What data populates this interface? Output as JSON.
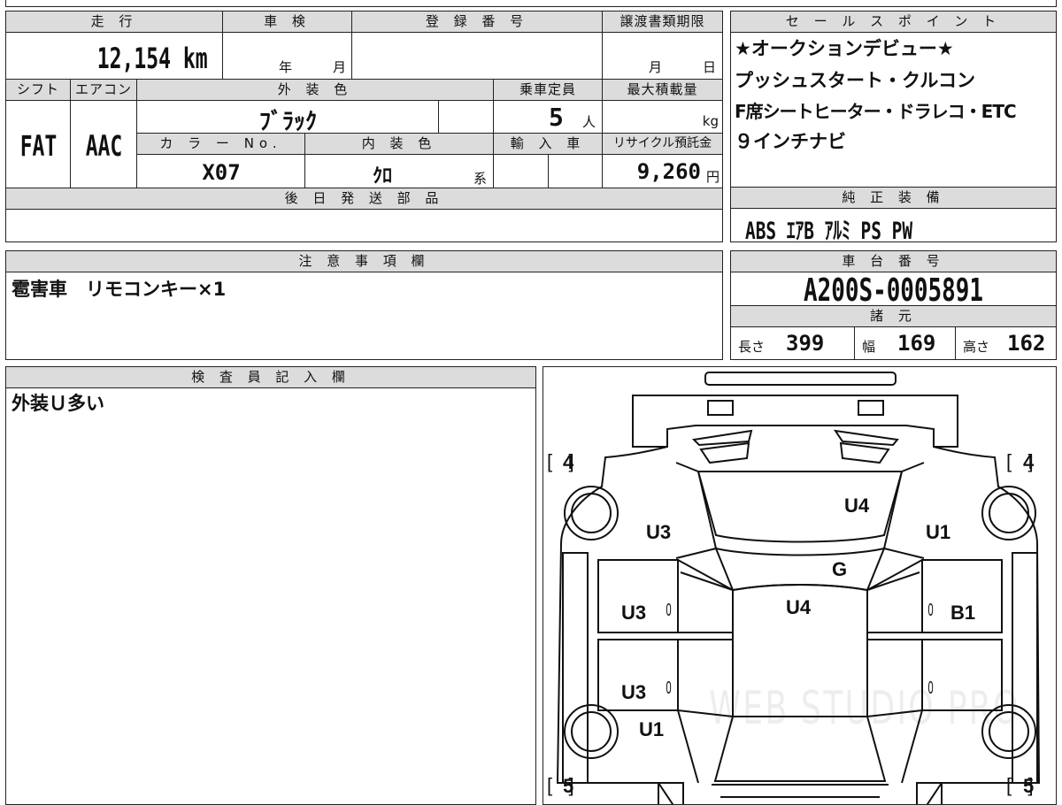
{
  "left_panel": {
    "mileage_label": "走 行",
    "mileage_value": "12,154 km",
    "inspection_label": "車 検",
    "inspection_year_unit": "年",
    "inspection_month_unit": "月",
    "registration_label": "登 録 番 号",
    "registration_value": "",
    "transfer_deadline_label": "譲渡書類期限",
    "transfer_month_unit": "月",
    "transfer_day_unit": "日",
    "shift_label": "シフト",
    "shift_value": "FAT",
    "aircon_label": "エアコン",
    "aircon_value": "AAC",
    "exterior_color_label": "外 装 色",
    "exterior_color_value": "ﾌﾞﾗｯｸ",
    "capacity_label": "乗車定員",
    "capacity_value": "5",
    "capacity_unit": "人",
    "max_load_label": "最大積載量",
    "max_load_unit": "kg",
    "color_no_label": "カ ラ ー No.",
    "color_no_value": "X07",
    "interior_color_label": "内 装 色",
    "interior_color_value": "ｸﾛ",
    "interior_color_suffix": "系",
    "import_label": "輸 入 車",
    "recycle_label": "リサイクル預託金",
    "recycle_value": "9,260",
    "recycle_unit": "円",
    "later_parts_label": "後 日 発 送 部 品",
    "later_parts_value": ""
  },
  "sales_points": {
    "header": "セ ー ル ス ポ イ ン ト",
    "lines": [
      "★オークションデビュー★",
      "プッシュスタート・クルコン",
      "F席シートヒーター・ドラレコ・ETC",
      "９インチナビ"
    ]
  },
  "equipment": {
    "header": "純 正 装 備",
    "value": "ABS  ｴｱB  ｱﾙﾐ  PS  PW"
  },
  "notes": {
    "header": "注 意 事 項 欄",
    "value": "雹害車　リモコンキー×1"
  },
  "chassis": {
    "header": "車 台 番 号",
    "value": "A200S-0005891"
  },
  "specs": {
    "header": "諸 元",
    "length_label": "長さ",
    "length_value": "399",
    "width_label": "幅",
    "width_value": "169",
    "height_label": "高さ",
    "height_value": "162"
  },
  "inspector": {
    "header": "検 査 員 記 入 欄",
    "value": "外装Ｕ多い"
  },
  "diagram": {
    "tire_front_left": "4",
    "tire_front_right": "4",
    "tire_rear_left": "5",
    "tire_rear_right": "5",
    "marks": {
      "hood": "U4",
      "front_left_fender": "U3",
      "front_right_fender": "U1",
      "windshield": "G",
      "roof": "U4",
      "front_left_door": "U3",
      "front_right_door": "B1",
      "rear_left_door": "U3",
      "rear_left_quarter": "U1",
      "zero_front_left_door": "0",
      "zero_front_right_door": "0",
      "zero_rear_left_door": "0",
      "zero_rear_right_door": "0"
    },
    "watermark": "WEB STUDIO PRO"
  }
}
